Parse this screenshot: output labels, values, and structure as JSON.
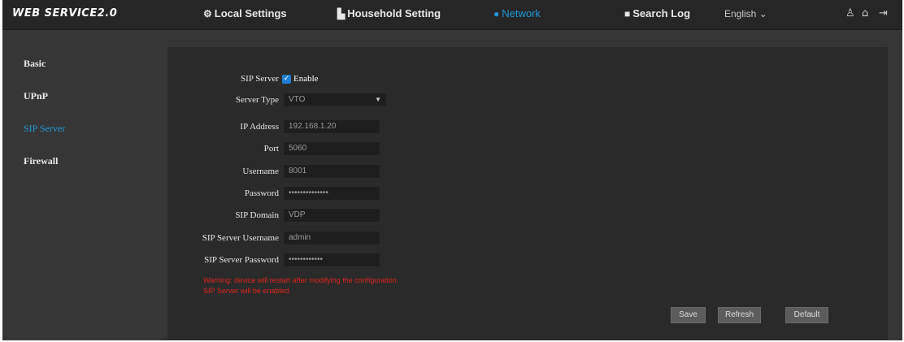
{
  "app": {
    "logo": "WEB SERVICE2.0"
  },
  "nav": {
    "items": [
      {
        "label": "Local Settings",
        "icon": "gear-icon"
      },
      {
        "label": "Household Setting",
        "icon": "building-icon"
      },
      {
        "label": "Network",
        "icon": "globe-icon"
      },
      {
        "label": "Search Log",
        "icon": "log-icon"
      }
    ],
    "language": "English",
    "active": "Network"
  },
  "top_icons": [
    "user-icon",
    "home-icon",
    "logout-icon"
  ],
  "sidebar": {
    "items": [
      {
        "label": "Basic"
      },
      {
        "label": "UPnP"
      },
      {
        "label": "SIP Server"
      },
      {
        "label": "Firewall"
      }
    ],
    "active": "SIP Server"
  },
  "form": {
    "sip_server": {
      "label": "SIP Server",
      "checkbox_label": "Enable",
      "checked": true
    },
    "server_type": {
      "label": "Server Type",
      "value": "VTO"
    },
    "ip_address": {
      "label": "IP Address",
      "value": "192.168.1.20"
    },
    "port": {
      "label": "Port",
      "value": "5060"
    },
    "username": {
      "label": "Username",
      "value": "8001"
    },
    "password": {
      "label": "Password",
      "value": "••••••••••••••"
    },
    "sip_domain": {
      "label": "SIP Domain",
      "value": "VDP"
    },
    "sip_server_username": {
      "label": "SIP Server Username",
      "value": "admin"
    },
    "sip_server_password": {
      "label": "SIP Server Password",
      "value": "••••••••••••"
    }
  },
  "warnings": [
    "Warning: device will restart after modifying the configuration.",
    "SIP Server will be enabled."
  ],
  "buttons": {
    "save": "Save",
    "refresh": "Refresh",
    "default": "Default"
  },
  "colors": {
    "accent": "#1f9bd9",
    "warning": "#e0261c",
    "background": "#363636"
  }
}
